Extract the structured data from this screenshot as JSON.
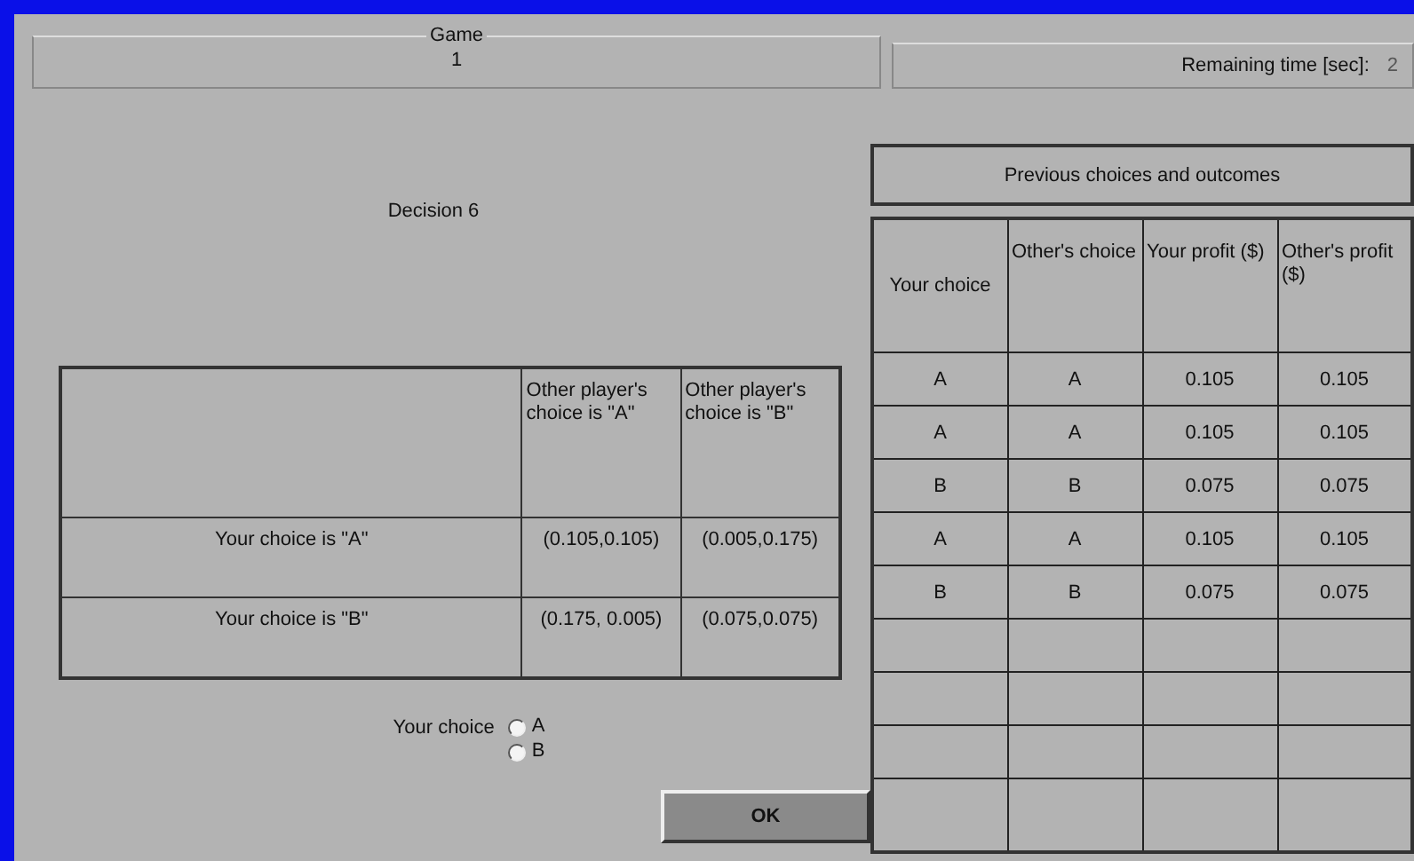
{
  "game": {
    "legend": "Game",
    "value": "1"
  },
  "timer": {
    "label": "Remaining time [sec]:",
    "value": "2"
  },
  "decision": {
    "title": "Decision 6"
  },
  "payoff_matrix": {
    "columns": [
      "Other player's choice is \"A\"",
      "Other player's choice is \"B\""
    ],
    "rows": [
      {
        "label": "Your choice is  \"A\"",
        "cells": [
          "(0.105,0.105)",
          "(0.005,0.175)"
        ]
      },
      {
        "label": "Your choice is  \"B\"",
        "cells": [
          "(0.175, 0.005)",
          "(0.075,0.075)"
        ]
      }
    ]
  },
  "choice": {
    "label": "Your choice",
    "options": [
      {
        "label": "A",
        "selected": false
      },
      {
        "label": "B",
        "selected": false
      }
    ]
  },
  "ok_button": {
    "label": "OK"
  },
  "history": {
    "title": "Previous choices and outcomes",
    "columns": [
      "Your choice",
      "Other's choice",
      "Your profit ($)",
      "Other's profit ($)"
    ],
    "rows": [
      [
        "A",
        "A",
        "0.105",
        "0.105"
      ],
      [
        "A",
        "A",
        "0.105",
        "0.105"
      ],
      [
        "B",
        "B",
        "0.075",
        "0.075"
      ],
      [
        "A",
        "A",
        "0.105",
        "0.105"
      ],
      [
        "B",
        "B",
        "0.075",
        "0.075"
      ]
    ]
  }
}
